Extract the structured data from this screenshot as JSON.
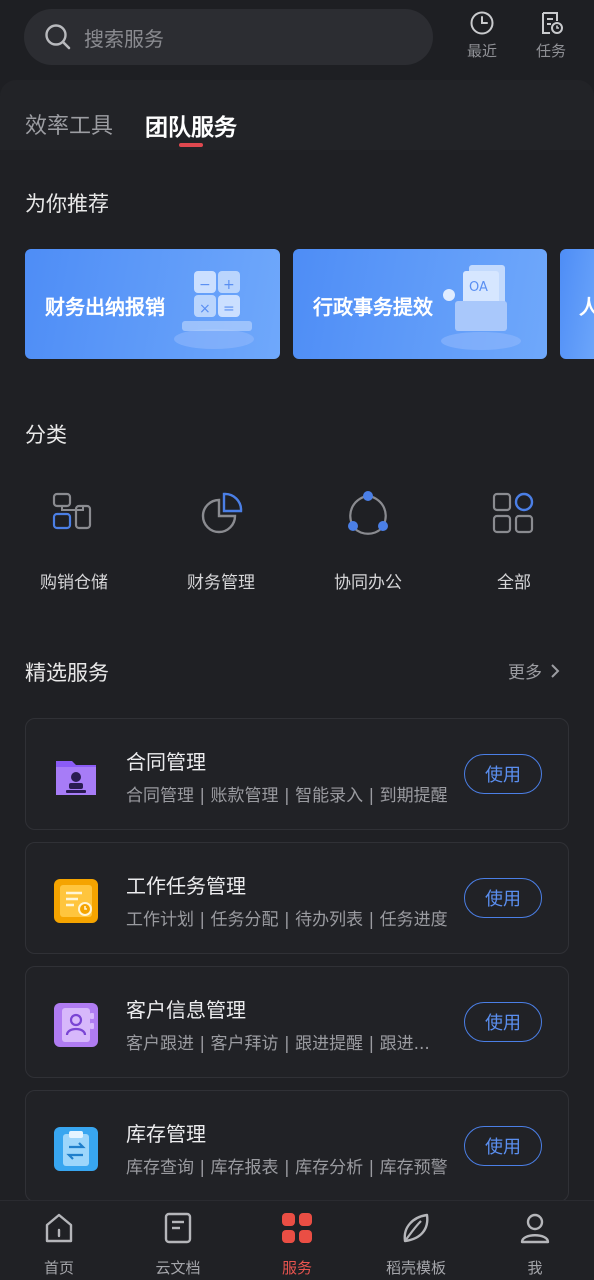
{
  "search": {
    "placeholder": "搜索服务"
  },
  "top_actions": [
    {
      "label": "最近",
      "icon": "clock-icon"
    },
    {
      "label": "任务",
      "icon": "task-list-icon"
    }
  ],
  "tabs": [
    {
      "label": "效率工具",
      "active": false
    },
    {
      "label": "团队服务",
      "active": true
    }
  ],
  "recommend": {
    "title": "为你推荐",
    "banners": [
      {
        "title": "财务出纳报销",
        "icon": "calculator-illustration"
      },
      {
        "title": "行政事务提效",
        "icon": "documents-illustration"
      },
      {
        "title": "人",
        "icon": "partial-banner"
      }
    ]
  },
  "categories": {
    "title": "分类",
    "items": [
      {
        "label": "购销仓储",
        "icon": "flow-blocks-icon"
      },
      {
        "label": "财务管理",
        "icon": "pie-chart-icon"
      },
      {
        "label": "协同办公",
        "icon": "collaboration-icon"
      },
      {
        "label": "全部",
        "icon": "grid-icon"
      }
    ]
  },
  "featured": {
    "title": "精选服务",
    "more": "更多",
    "services": [
      {
        "name": "合同管理",
        "desc": "合同管理 | 账款管理 | 智能录入 | 到期提醒",
        "button": "使用",
        "icon": "contract-folder-icon"
      },
      {
        "name": "工作任务管理",
        "desc": "工作计划 | 任务分配 | 待办列表 | 任务进度",
        "button": "使用",
        "icon": "task-board-icon"
      },
      {
        "name": "客户信息管理",
        "desc": "客户跟进 | 客户拜访 | 跟进提醒 | 跟进...",
        "button": "使用",
        "icon": "contact-book-icon"
      },
      {
        "name": "库存管理",
        "desc": "库存查询 | 库存报表 | 库存分析 | 库存预警",
        "button": "使用",
        "icon": "inventory-clipboard-icon"
      }
    ]
  },
  "bottom_nav": [
    {
      "label": "首页",
      "icon": "home-icon",
      "active": false
    },
    {
      "label": "云文档",
      "icon": "document-icon",
      "active": false
    },
    {
      "label": "服务",
      "icon": "services-grid-icon",
      "active": true
    },
    {
      "label": "稻壳模板",
      "icon": "leaf-icon",
      "active": false
    },
    {
      "label": "我",
      "icon": "user-icon",
      "active": false
    }
  ],
  "colors": {
    "accent_blue": "#4b7fe6",
    "accent_red": "#e0484f",
    "background": "#1e1f23"
  }
}
